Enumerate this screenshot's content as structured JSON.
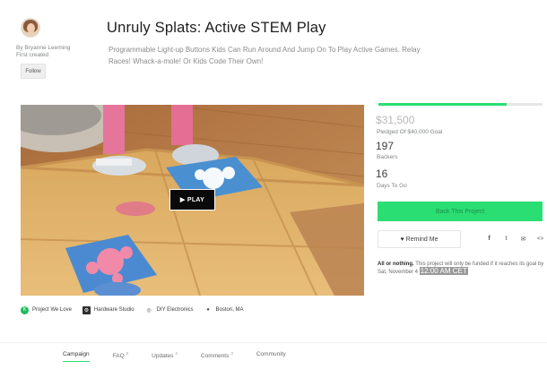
{
  "project": {
    "title": "Unruly Splats: Active STEM Play",
    "blurb": "Programmable Light-up Buttons Kids Can Run Around And Jump On To Play Active Games. Relay Races! Whack-a-mole! Or Kids Code Their Own!"
  },
  "creator": {
    "by": "By Bryanne Leeming",
    "status": "First created",
    "follow_label": "Follow"
  },
  "video": {
    "play_label": "▶  PLAY"
  },
  "categories": {
    "pick": "Project We Love",
    "studio": "Hardware Studio",
    "category": "DIY Electronics",
    "location": "Boston, MA"
  },
  "funding": {
    "progress": 0.78,
    "pledged": "$31,500",
    "goal_text": "Pledged Of $40,000 Goal",
    "backers": "197",
    "backers_label": "Backers",
    "days": "16",
    "days_label": "Days To Go",
    "back_label": "Back This Project",
    "remind_label": "Remind Me",
    "fine_prefix": "All or nothing.",
    "fine_body": " This project will only be funded if it reaches its goal by Sat, November 4",
    "fine_time": "12:00 AM CET"
  },
  "socials": {
    "facebook": "f",
    "twitter": "t",
    "email": "✉",
    "embed": "<>"
  },
  "tabs": [
    {
      "label": "Campaign",
      "count": ""
    },
    {
      "label": "FAQ",
      "count": "2"
    },
    {
      "label": "Updates",
      "count": "4"
    },
    {
      "label": "Comments",
      "count": "3"
    },
    {
      "label": "Community",
      "count": ""
    }
  ],
  "colors": {
    "accent": "#2bde73",
    "text": "#282828",
    "muted": "#828587"
  }
}
